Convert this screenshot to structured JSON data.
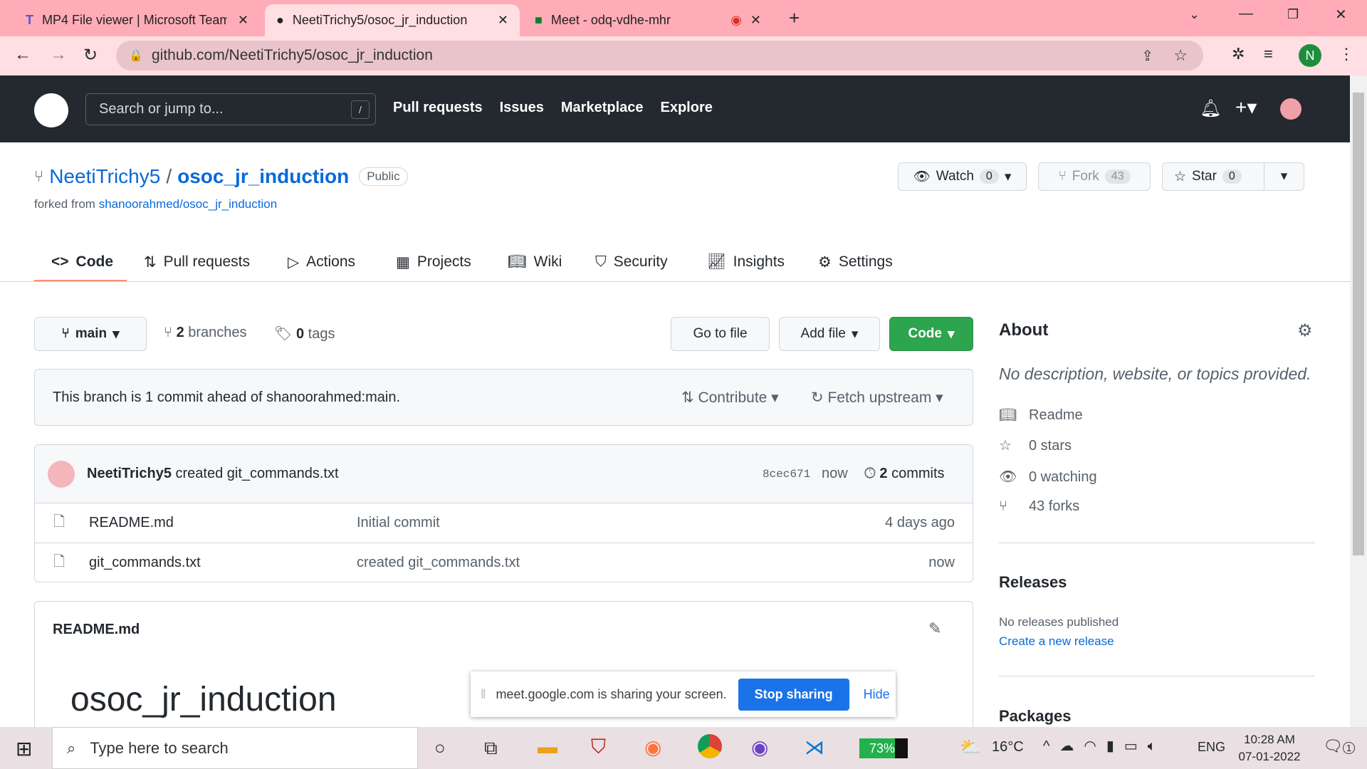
{
  "browser": {
    "tabs": [
      {
        "title": "MP4 File viewer | Microsoft Teams"
      },
      {
        "title": "NeetiTrichy5/osoc_jr_induction"
      },
      {
        "title": "Meet - odq-vdhe-mhr"
      }
    ],
    "url": "github.com/NeetiTrichy5/osoc_jr_induction",
    "profile": "N"
  },
  "gh": {
    "search_placeholder": "Search or jump to...",
    "slash": "/",
    "nav": [
      "Pull requests",
      "Issues",
      "Marketplace",
      "Explore"
    ]
  },
  "repo": {
    "owner": "NeetiTrichy5",
    "sep": "/",
    "name": "osoc_jr_induction",
    "visibility": "Public",
    "forked_prefix": "forked from",
    "forked_from": "shanoorahmed/osoc_jr_induction",
    "watch": "Watch",
    "watch_count": "0",
    "fork": "Fork",
    "fork_count": "43",
    "star": "Star",
    "star_count": "0",
    "tabs": [
      "Code",
      "Pull requests",
      "Actions",
      "Projects",
      "Wiki",
      "Security",
      "Insights",
      "Settings"
    ]
  },
  "main": {
    "branch": "main",
    "branches_count": "2",
    "branches_label": "branches",
    "tags_count": "0",
    "tags_label": "tags",
    "go_to_file": "Go to file",
    "add_file": "Add file",
    "code": "Code",
    "ahead_text": "This branch is 1 commit ahead of shanoorahmed:main.",
    "contribute": "Contribute",
    "fetch": "Fetch upstream",
    "commit": {
      "author": "NeetiTrichy5",
      "message": "created git_commands.txt",
      "sha": "8cec671",
      "time": "now",
      "commits_count": "2",
      "commits_label": "commits"
    },
    "files": [
      {
        "name": "README.md",
        "message": "Initial commit",
        "time": "4 days ago"
      },
      {
        "name": "git_commands.txt",
        "message": "created git_commands.txt",
        "time": "now"
      }
    ],
    "readme_title": "README.md",
    "readme_heading": "osoc_jr_induction"
  },
  "about": {
    "title": "About",
    "description": "No description, website, or topics provided.",
    "readme": "Readme",
    "stars": "0 stars",
    "watching": "0 watching",
    "forks": "43 forks",
    "releases_title": "Releases",
    "releases_none": "No releases published",
    "create_release": "Create a new release",
    "packages_title": "Packages"
  },
  "share": {
    "text": "meet.google.com is sharing your screen.",
    "stop": "Stop sharing",
    "hide": "Hide"
  },
  "taskbar": {
    "search_placeholder": "Type here to search",
    "battery": "73%",
    "temp": "16°C",
    "lang": "ENG",
    "time": "10:28 AM",
    "date": "07-01-2022",
    "notifications": "1"
  }
}
